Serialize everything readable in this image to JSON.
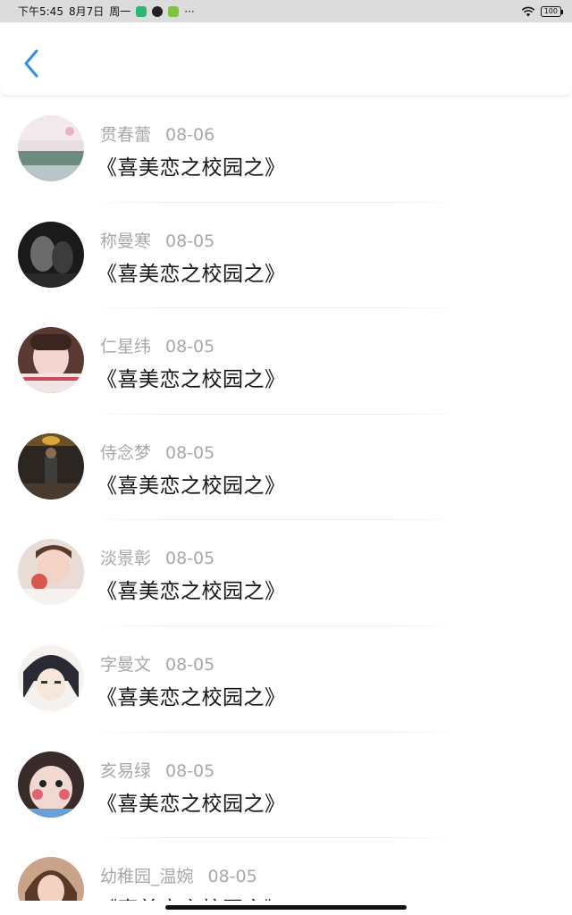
{
  "status_bar": {
    "time": "下午5:45",
    "date": "8月7日",
    "weekday": "周一",
    "more": "···",
    "battery": "100"
  },
  "header": {
    "back_icon": "chevron-left-icon",
    "accent_color": "#2f8ee6"
  },
  "items": [
    {
      "name": "贯春蕾",
      "date": "08-06",
      "title": "《喜美恋之校园之》"
    },
    {
      "name": "称曼寒",
      "date": "08-05",
      "title": "《喜美恋之校园之》"
    },
    {
      "name": "仁星纬",
      "date": "08-05",
      "title": "《喜美恋之校园之》"
    },
    {
      "name": "侍念梦",
      "date": "08-05",
      "title": "《喜美恋之校园之》"
    },
    {
      "name": "淡景彰",
      "date": "08-05",
      "title": "《喜美恋之校园之》"
    },
    {
      "name": "字曼文",
      "date": "08-05",
      "title": "《喜美恋之校园之》"
    },
    {
      "name": "亥易绿",
      "date": "08-05",
      "title": "《喜美恋之校园之》"
    },
    {
      "name": "幼稚园_温婉",
      "date": "08-05",
      "title": "《喜美恋之校园之》"
    }
  ]
}
